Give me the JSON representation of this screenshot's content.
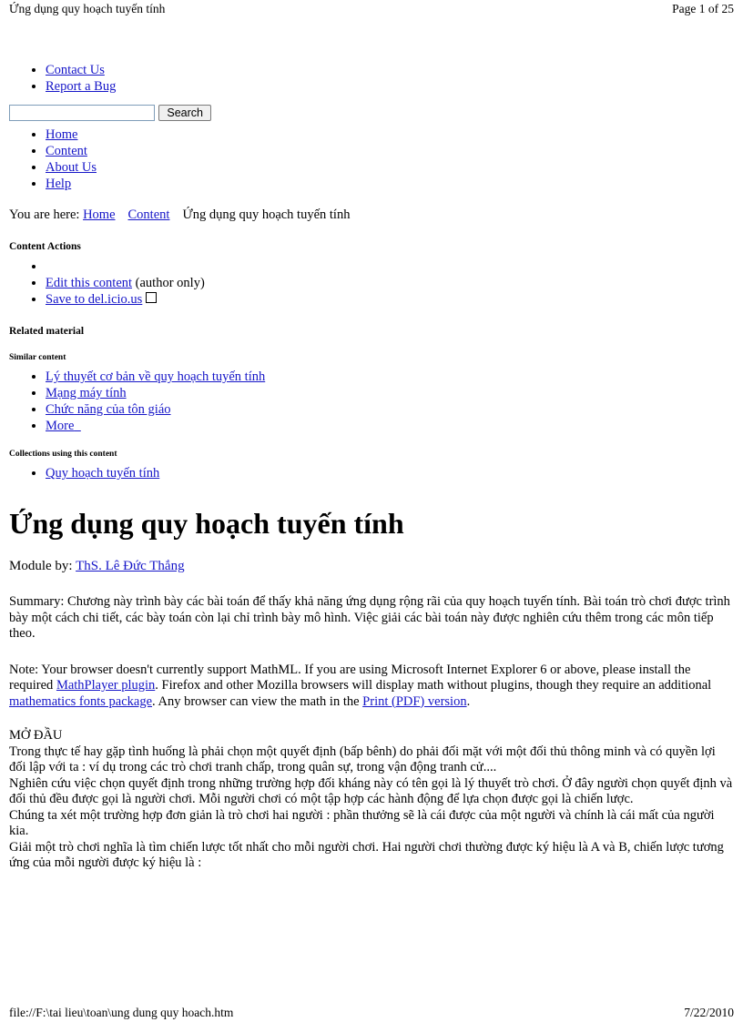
{
  "print_header": {
    "left_title": "Ứng dụng quy hoạch tuyến tính",
    "right_page": "Page 1 of 25"
  },
  "print_footer": {
    "left_path": "file://F:\\tai lieu\\toan\\ung dung quy hoach.htm",
    "right_date": "7/22/2010"
  },
  "portal_links": [
    {
      "label": "Contact Us"
    },
    {
      "label": "Report a Bug"
    }
  ],
  "search": {
    "value": "",
    "placeholder": "",
    "button_label": "Search"
  },
  "site_nav": [
    {
      "label": "Home"
    },
    {
      "label": "Content"
    },
    {
      "label": "About Us"
    },
    {
      "label": "Help"
    }
  ],
  "breadcrumb": {
    "prefix": "You are here:",
    "home": "Home",
    "content": "Content",
    "current": "Ứng dụng quy hoạch tuyến tính"
  },
  "content_actions": {
    "heading": "Content Actions",
    "edit_link": "Edit this content",
    "edit_note": "(author only)",
    "delicious_link": "Save to del.icio.us",
    "delicious_icon": "broken-image-icon"
  },
  "related_material": {
    "heading": "Related material",
    "similar_heading": "Similar content",
    "similar_items": [
      {
        "label": "Lý thuyết cơ bản về quy hoạch tuyến tính"
      },
      {
        "label": "Mạng máy tính"
      },
      {
        "label": "Chức năng của tôn giáo"
      },
      {
        "label": "More"
      }
    ],
    "collections_heading": "Collections using this content",
    "collections_items": [
      {
        "label": "Quy hoạch tuyến tính"
      }
    ]
  },
  "module": {
    "title": "Ứng dụng quy hoạch tuyến tính",
    "by_prefix": "Module by:",
    "author": "ThS. Lê Đức Thắng",
    "summary": "Summary: Chương này trình bày các bài toán để thấy khả năng ứng dụng rộng rãi của quy hoạch tuyến tính. Bài toán trò chơi được trình bày một cách chi tiết, các bày toán còn lại chỉ trình bày mô hình. Việc giải các bài toán này được nghiên cứu thêm trong các môn tiếp theo.",
    "note": {
      "text_1": "Note: Your browser doesn't currently support MathML. If you are using Microsoft Internet Explorer 6 or above, please install the required ",
      "link_1": "MathPlayer plugin",
      "text_2": ". Firefox and other Mozilla browsers will display math without plugins, though they require an additional ",
      "link_2": "mathematics fonts package",
      "text_3": ". Any browser can view the math in the ",
      "link_3": "Print (PDF) version",
      "text_4": "."
    }
  },
  "content_body": {
    "heading": "MỞ ĐẦU",
    "lines": [
      "Trong thực tế hay gặp tình huống là phải chọn một quyết định (bấp bênh) do phải đối mặt với một đối thủ thông minh và có quyền lợi đối lập với ta : ví dụ trong các trò chơi tranh chấp, trong quân sự, trong vận động tranh cử....",
      "Nghiên cứu việc chọn quyết định trong những trường hợp đối kháng này có tên gọi là lý thuyết trò chơi. Ở đây người chọn quyết định và đối thủ đều được gọi là người chơi. Mỗi người chơi có một tập hợp các hành động để lựa chọn được gọi là chiến lược.",
      "Chúng ta xét một trường hợp đơn giản là trò chơi hai người : phần thưởng sẽ là cái được của một người và chính là cái mất của người kia.",
      "Giải một trò chơi nghĩa là tìm chiến lược tốt nhất cho mỗi người chơi. Hai người chơi thường được ký hiệu là A và B, chiến lược tương ứng của mỗi người được ký hiệu là :"
    ]
  },
  "colors": {
    "link": "#1616c8",
    "text": "#000000",
    "background": "#ffffff",
    "input_border": "#7f9db9",
    "button_face": "#f0f0f0"
  }
}
